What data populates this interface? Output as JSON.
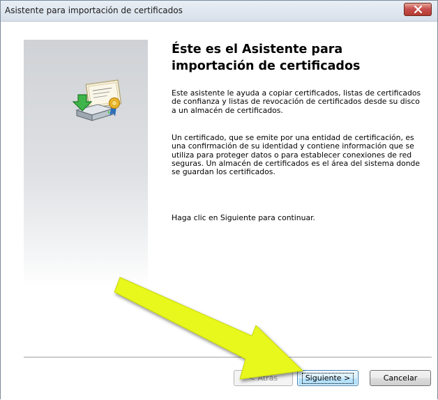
{
  "window": {
    "title": "Asistente para importación de certificados"
  },
  "main": {
    "heading": "Éste es el Asistente para importación de certificados",
    "paragraph1": "Este asistente le ayuda a copiar certificados, listas de certificados de confianza y listas de revocación de certificados desde su disco a un almacén de certificados.",
    "paragraph2": "Un certificado, que se emite por una entidad de certificación, es una confirmación de su identidad y contiene información que se utiliza para proteger datos o para establecer conexiones de red seguras. Un almacén de certificados es el área del sistema donde se guardan los certificados.",
    "paragraph3": "Haga clic en Siguiente para continuar."
  },
  "buttons": {
    "back": "< Atrás",
    "next": "Siguiente >",
    "cancel": "Cancelar"
  },
  "icons": {
    "close": "close-icon",
    "wizard": "certificate-import-icon",
    "annotation_arrow": "yellow-arrow-annotation"
  },
  "colors": {
    "arrow": "#e8f71d",
    "close_button": "#c75050",
    "default_button_border": "#3c7fb1"
  }
}
